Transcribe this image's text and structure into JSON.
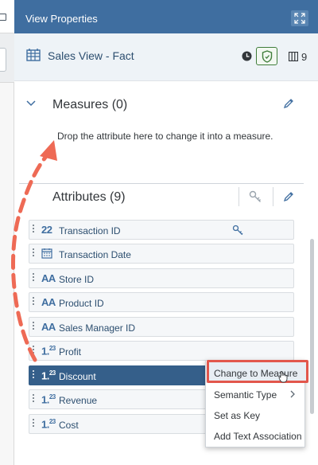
{
  "header": {
    "title": "View Properties",
    "expand_icon": "expand-icon"
  },
  "view": {
    "title": "Sales View - Fact",
    "column_count": "9"
  },
  "measures": {
    "title": "Measures (0)",
    "drop_hint": "Drop the attribute here to change it into a measure."
  },
  "attributes": {
    "title": "Attributes (9)",
    "items": [
      {
        "type": "22",
        "label": "Transaction ID",
        "is_key": true
      },
      {
        "type": "date",
        "label": "Transaction Date"
      },
      {
        "type": "AA",
        "label": "Store ID"
      },
      {
        "type": "AA",
        "label": "Product ID"
      },
      {
        "type": "AA",
        "label": "Sales Manager ID"
      },
      {
        "type": "123",
        "label": "Profit"
      },
      {
        "type": "123",
        "label": "Discount",
        "selected": true
      },
      {
        "type": "123",
        "label": "Revenue"
      },
      {
        "type": "123",
        "label": "Cost"
      }
    ]
  },
  "context_menu": {
    "items": [
      {
        "label": "Change to Measure"
      },
      {
        "label": "Semantic Type"
      },
      {
        "label": "Set as Key"
      },
      {
        "label": "Add Text Association"
      }
    ]
  },
  "colors": {
    "header": "#3f6ea0",
    "selected_row": "#355f8a",
    "annotation": "#e2574c"
  }
}
